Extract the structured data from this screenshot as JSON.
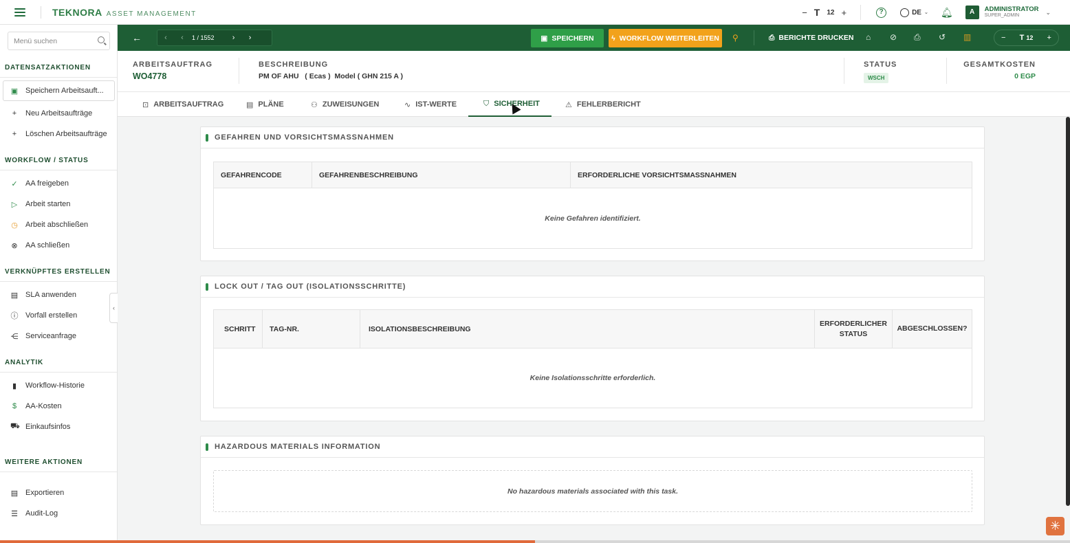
{
  "app": {
    "brand_name": "TEKNORA",
    "brand_sub": "ASSET MANAGEMENT",
    "font_size": "12",
    "language": "DE",
    "user_initial": "A",
    "user_name": "ADMINISTRATOR",
    "user_role": "SUPER_ADMIN"
  },
  "sidebar": {
    "search_placeholder": "Menü suchen",
    "sections": [
      {
        "title": "DATENSATZAKTIONEN",
        "items": [
          {
            "label": "Speichern Arbeitsauft...",
            "icon": "save-icon"
          },
          {
            "label": "Neu Arbeitsaufträge",
            "icon": "plus-icon"
          },
          {
            "label": "Löschen Arbeitsaufträge",
            "icon": "plus-icon"
          }
        ]
      },
      {
        "title": "WORKFLOW / STATUS",
        "items": [
          {
            "label": "AA freigeben",
            "icon": "check-circle-icon"
          },
          {
            "label": "Arbeit starten",
            "icon": "play-icon"
          },
          {
            "label": "Arbeit abschließen",
            "icon": "check-circle-icon"
          },
          {
            "label": "AA schließen",
            "icon": "close-circle-icon"
          }
        ]
      },
      {
        "title": "VERKNÜPFTES ERSTELLEN",
        "items": [
          {
            "label": "SLA anwenden",
            "icon": "document-icon"
          },
          {
            "label": "Vorfall erstellen",
            "icon": "info-icon"
          },
          {
            "label": "Serviceanfrage",
            "icon": "share-icon"
          }
        ]
      },
      {
        "title": "ANALYTIK",
        "items": [
          {
            "label": "Workflow-Historie",
            "icon": "bar-chart-icon"
          },
          {
            "label": "AA-Kosten",
            "icon": "dollar-icon"
          },
          {
            "label": "Einkaufsinfos",
            "icon": "cart-icon"
          }
        ]
      },
      {
        "title": "WEITERE AKTIONEN",
        "items": [
          {
            "label": "Exportieren",
            "icon": "document-icon"
          },
          {
            "label": "Audit-Log",
            "icon": "list-icon"
          }
        ]
      }
    ]
  },
  "toolbar": {
    "pager": "1 / 1552",
    "save_label": "SPEICHERN",
    "workflow_label": "WORKFLOW WEITERLEITEN",
    "print_label": "BERICHTE DRUCKEN",
    "font_size": "12"
  },
  "header": {
    "wo_label": "ARBEITSAUFTRAG",
    "wo_value": "WO4778",
    "desc_label": "BESCHREIBUNG",
    "desc_value": "PM OF AHU   ( Ecas )  Model ( GHN 215 A )",
    "status_label": "STATUS",
    "status_value": "WSCH",
    "cost_label": "GESAMTKOSTEN",
    "cost_value": "0 EGP"
  },
  "tabs": [
    {
      "label": "ARBEITSAUFTRAG",
      "icon": "briefcase-icon"
    },
    {
      "label": "PLÄNE",
      "icon": "document-icon"
    },
    {
      "label": "ZUWEISUNGEN",
      "icon": "user-icon"
    },
    {
      "label": "IST-WERTE",
      "icon": "activity-icon"
    },
    {
      "label": "SICHERHEIT",
      "icon": "shield-icon"
    },
    {
      "label": "FEHLERBERICHT",
      "icon": "warning-icon"
    }
  ],
  "hazards": {
    "title": "GEFAHREN UND VORSICHTSMASSNAHMEN",
    "columns": [
      "GEFAHRENCODE",
      "GEFAHRENBESCHREIBUNG",
      "ERFORDERLICHE VORSICHTSMASSNAHMEN"
    ],
    "empty": "Keine Gefahren identifiziert."
  },
  "loto": {
    "title": "LOCK OUT / TAG OUT (ISOLATIONSSCHRITTE)",
    "columns": [
      "SCHRITT",
      "TAG-NR.",
      "ISOLATIONSBESCHREIBUNG",
      "ERFORDERLICHER STATUS",
      "ABGESCHLOSSEN?"
    ],
    "empty": "Keine Isolationsschritte erforderlich."
  },
  "hazmat": {
    "title": "HAZARDOUS MATERIALS INFORMATION",
    "empty": "No hazardous materials associated with this task."
  },
  "progress": {
    "fraction": 0.5
  },
  "colors": {
    "brand": "#1e5e35",
    "save": "#2f9f48",
    "workflow": "#f2a21b",
    "accent": "#e06a3b"
  }
}
